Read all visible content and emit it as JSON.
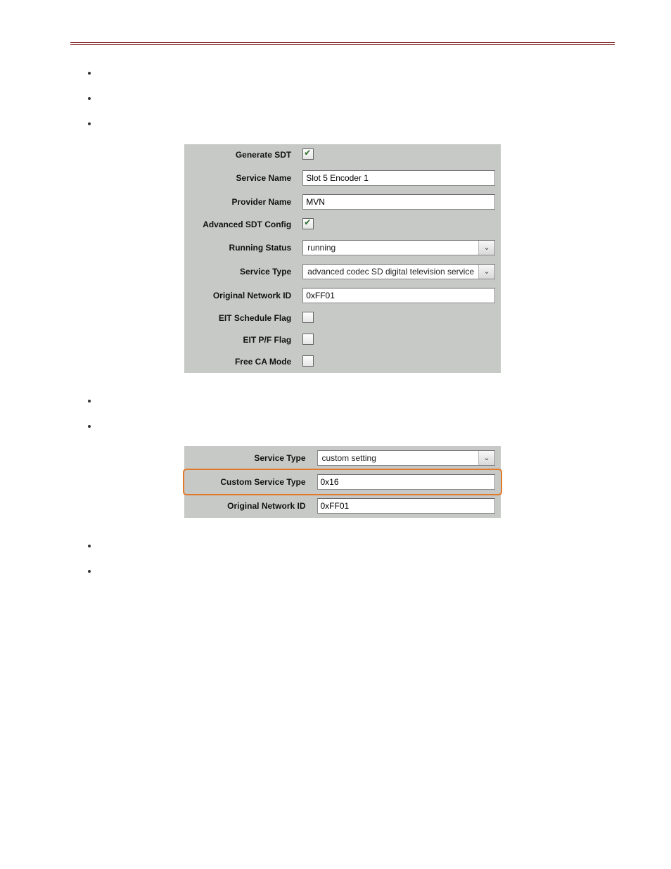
{
  "bullets1": {
    "b1": " ",
    "b2": " ",
    "b3": " "
  },
  "panel1": {
    "generateSDT": {
      "label": "Generate SDT"
    },
    "serviceName": {
      "label": "Service Name",
      "value": "Slot 5 Encoder 1"
    },
    "providerName": {
      "label": "Provider Name",
      "value": "MVN"
    },
    "advancedSDT": {
      "label": "Advanced SDT Config"
    },
    "runningStatus": {
      "label": "Running Status",
      "value": "running"
    },
    "serviceType": {
      "label": "Service Type",
      "value": "advanced codec SD digital television service"
    },
    "origNetId": {
      "label": "Original Network ID",
      "value": "0xFF01"
    },
    "eitSchedule": {
      "label": "EIT Schedule Flag"
    },
    "eitPF": {
      "label": "EIT P/F Flag"
    },
    "freeCA": {
      "label": "Free CA Mode"
    }
  },
  "bullets2": {
    "b1": " ",
    "b2": " "
  },
  "panel2": {
    "serviceType": {
      "label": "Service Type",
      "value": "custom setting"
    },
    "customServiceType": {
      "label": "Custom Service Type",
      "value": "0x16"
    },
    "origNetId": {
      "label": "Original Network ID",
      "value": "0xFF01"
    }
  },
  "bullets3": {
    "b1": " ",
    "b2": " "
  }
}
